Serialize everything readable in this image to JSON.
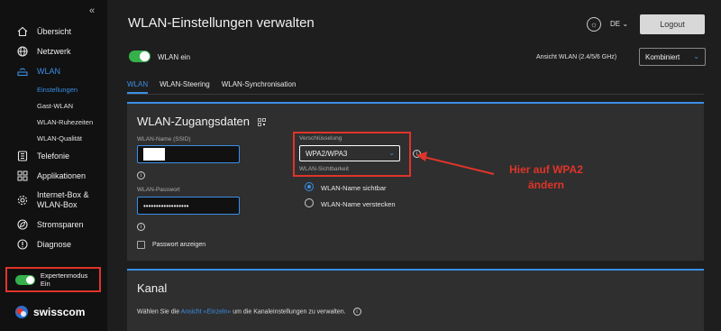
{
  "sidebar": {
    "collapse_glyph": "«",
    "items": [
      {
        "label": "Übersicht",
        "icon": "home-icon"
      },
      {
        "label": "Netzwerk",
        "icon": "globe-icon"
      },
      {
        "label": "WLAN",
        "icon": "wifi-router-icon",
        "active": true
      },
      {
        "label": "Telefonie",
        "icon": "phone-icon"
      },
      {
        "label": "Applikationen",
        "icon": "apps-icon"
      },
      {
        "label": "Internet-Box &",
        "label2": "WLAN-Box",
        "icon": "gear-icon"
      },
      {
        "label": "Stromsparen",
        "icon": "leaf-icon"
      },
      {
        "label": "Diagnose",
        "icon": "alert-icon"
      }
    ],
    "sub_items": [
      "Einstellungen",
      "Gast-WLAN",
      "WLAN-Ruhezeiten",
      "WLAN-Qualität"
    ],
    "expert_mode": "Expertenmodus Ein",
    "brand": "swisscom"
  },
  "header": {
    "title": "WLAN-Einstellungen verwalten",
    "lang": "DE",
    "logout": "Logout",
    "wlan_toggle": "WLAN ein",
    "view_label": "Ansicht WLAN (2.4/5/6 GHz)",
    "view_value": "Kombiniert"
  },
  "tabs": [
    "WLAN",
    "WLAN-Steering",
    "WLAN-Synchronisation"
  ],
  "access": {
    "title": "WLAN-Zugangsdaten",
    "ssid_label": "WLAN-Name (SSID)",
    "password_label": "WLAN-Passwort",
    "password_value": "••••••••••••••••••",
    "show_password": "Passwort anzeigen",
    "encryption_label": "Verschlüsselung",
    "encryption_value": "WPA2/WPA3",
    "visibility_label": "WLAN-Sichtbarkeit",
    "visible": "WLAN-Name sichtbar",
    "hidden": "WLAN-Name verstecken"
  },
  "annotation": {
    "line1": "Hier auf WPA2",
    "line2": "ändern",
    "color": "#e0342a"
  },
  "channel": {
    "title": "Kanal",
    "text_pre": "Wählen Sie die",
    "link": "Ansicht «Einzeln»",
    "text_post": "um die Kanaleinstellungen zu verwalten."
  },
  "colors": {
    "accent": "#3a8fe6",
    "toggle_on": "#35b04a",
    "highlight": "#e0342a"
  }
}
